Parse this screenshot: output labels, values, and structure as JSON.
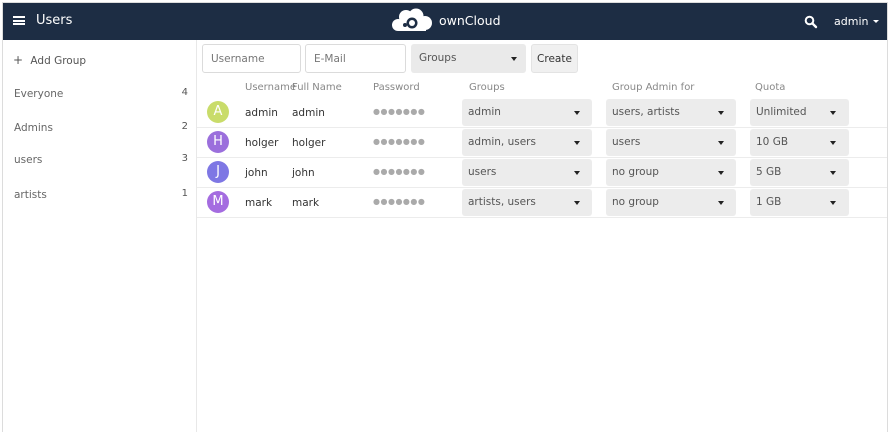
{
  "header": {
    "app_title": "Users",
    "brand": "ownCloud",
    "user_menu_label": "admin",
    "colors": {
      "bar": "#1d2d44"
    }
  },
  "sidebar": {
    "add_group_label": "Add Group",
    "groups": [
      {
        "name": "Everyone",
        "count": "4"
      },
      {
        "name": "Admins",
        "count": "2"
      },
      {
        "name": "users",
        "count": "3"
      },
      {
        "name": "artists",
        "count": "1"
      }
    ]
  },
  "toolbar": {
    "username_placeholder": "Username",
    "email_placeholder": "E-Mail",
    "groups_select": "Groups",
    "create_label": "Create"
  },
  "table": {
    "headers": {
      "username": "Username",
      "fullname": "Full Name",
      "password": "Password",
      "groups": "Groups",
      "group_admin": "Group Admin for",
      "quota": "Quota"
    },
    "rows": [
      {
        "initial": "A",
        "avatar_color": "#c9dc6a",
        "username": "admin",
        "fullname": "admin",
        "password": "●●●●●●●",
        "groups": "admin",
        "group_admin": "users, artists",
        "quota": "Unlimited"
      },
      {
        "initial": "H",
        "avatar_color": "#9b6fdc",
        "username": "holger",
        "fullname": "holger",
        "password": "●●●●●●●",
        "groups": "admin, users",
        "group_admin": "users",
        "quota": "10 GB"
      },
      {
        "initial": "J",
        "avatar_color": "#7e77e4",
        "username": "john",
        "fullname": "john",
        "password": "●●●●●●●",
        "groups": "users",
        "group_admin": "no group",
        "quota": "5 GB"
      },
      {
        "initial": "M",
        "avatar_color": "#a46ce0",
        "username": "mark",
        "fullname": "mark",
        "password": "●●●●●●●",
        "groups": "artists, users",
        "group_admin": "no group",
        "quota": "1 GB"
      }
    ]
  }
}
